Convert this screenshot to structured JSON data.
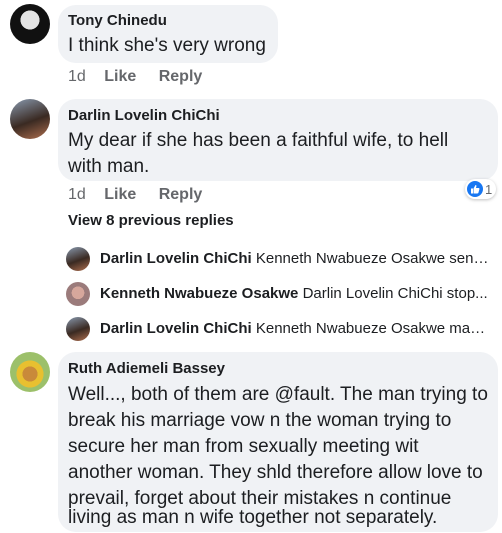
{
  "comments": [
    {
      "author": "Tony Chinedu",
      "text": "I think she's very wrong",
      "time": "1d",
      "like_label": "Like",
      "reply_label": "Reply"
    },
    {
      "author": "Darlin Lovelin ChiChi",
      "text_line1": "My dear if she has been a faithful wife,  to hell",
      "text_line2": "with man.",
      "time": "1d",
      "like_label": "Like",
      "reply_label": "Reply",
      "reaction_count": "1"
    },
    {
      "author": "Ruth Adiemeli Bassey",
      "lines": [
        "Well..., both of them are @fault. The man trying to",
        "break his marriage vow n the woman trying to",
        "secure her man from sexually meeting wit",
        "another woman. They shld therefore allow love to",
        "prevail, forget about their mistakes n continue",
        "living as man n wife together not separately."
      ]
    }
  ],
  "view_previous_replies": "View 8 previous replies",
  "replies": [
    {
      "author": "Darlin Lovelin ChiChi",
      "text": "Kenneth Nwabueze Osakwe sense..."
    },
    {
      "author": "Kenneth Nwabueze Osakwe",
      "text": "Darlin Lovelin ChiChi stop..."
    },
    {
      "author": "Darlin Lovelin ChiChi",
      "text": "Kenneth Nwabueze Osakwe man i..."
    }
  ],
  "colors": {
    "bubble": "#f0f2f5",
    "secondary_text": "#65676b",
    "like_blue": "#1877f2"
  }
}
